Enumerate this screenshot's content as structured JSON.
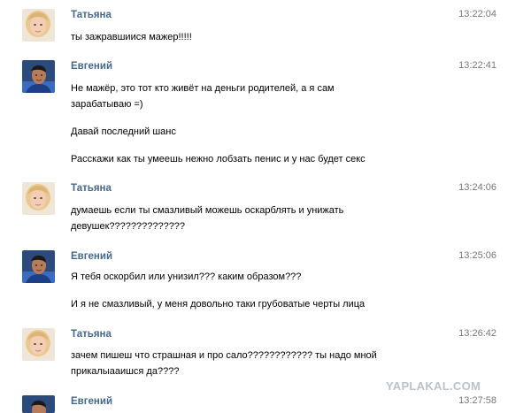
{
  "messages": [
    {
      "author": "Татьяна",
      "time": "13:22:04",
      "lines": [
        "ты зажравшиися мажер!!!!!"
      ]
    },
    {
      "author": "Евгений",
      "time": "13:22:41",
      "lines": [
        "Не мажёр, это тот кто живёт на деньги родителей, а я сам",
        "зарабатываю =)",
        "Давай последний шанс",
        "Расскажи как ты умеешь нежно лобзать пенис и у нас будет секс"
      ]
    },
    {
      "author": "Татьяна",
      "time": "13:24:06",
      "lines": [
        "думаешь если ты смазливый можешь оскарблять и унижать",
        "девушек??????????????"
      ]
    },
    {
      "author": "Евгений",
      "time": "13:25:06",
      "lines": [
        "Я тебя оскорбил или унизил??? каким образом???",
        "И я не смазливый, у меня довольно таки грубоватые черты лица"
      ]
    },
    {
      "author": "Татьяна",
      "time": "13:26:42",
      "lines": [
        "зачем пишеш что страшная и про сало???????????? ты надо мной",
        "прикалыааишся да????"
      ]
    },
    {
      "author": "Евгений",
      "time": "13:27:58",
      "lines": []
    }
  ],
  "watermark": "YAPLAKAL.COM"
}
